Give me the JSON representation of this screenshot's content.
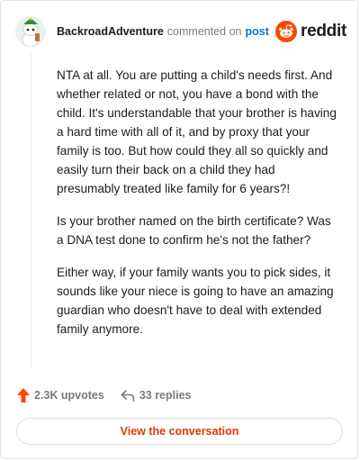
{
  "header": {
    "username": "BackroadAdventure",
    "action_text": "commented on",
    "post_link": "post",
    "brand": "reddit"
  },
  "comment": {
    "paragraphs": [
      "NTA at all. You are putting a child's needs first. And whether related or not, you have a bond with the child. It's understandable that your brother is having a hard time with all of it, and by proxy that your family is too. But how could they all so quickly and easily turn their back on a child they had presumably treated like family for 6 years?!",
      "Is your brother named on the birth certificate? Was a DNA test done to confirm he's not the father?",
      "Either way, if your family wants you to pick sides, it sounds like your niece is going to have an amazing guardian who doesn't have to deal with extended family anymore."
    ]
  },
  "actions": {
    "upvotes": "2.3K upvotes",
    "replies": "33 replies"
  },
  "cta": {
    "label": "View the conversation"
  },
  "icons": {
    "upvote": "upvote-arrow-icon",
    "reply": "reply-arrow-icon",
    "brand": "reddit-snoo-icon",
    "avatar": "snoo-avatar-icon"
  },
  "colors": {
    "brand_orange": "#ff4500",
    "link_blue": "#0079d3",
    "cta_text": "#d93a00",
    "meta_gray": "#787c7e"
  }
}
